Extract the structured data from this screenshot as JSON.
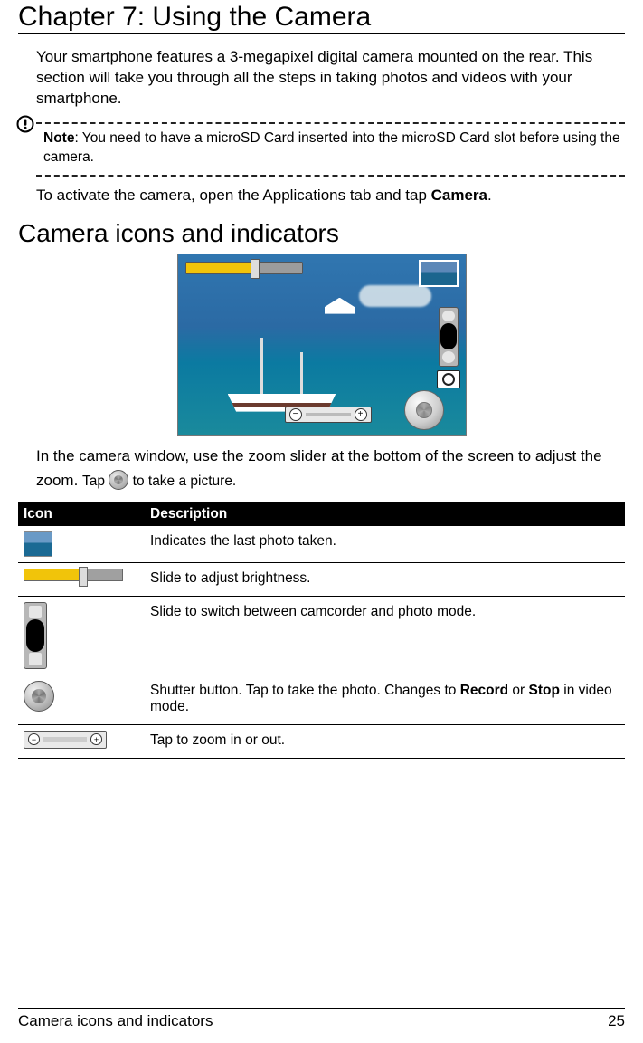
{
  "chapter_title": "Chapter 7: Using the Camera",
  "intro": "Your smartphone features a 3-megapixel digital camera mounted on the rear. This section will take you through all the steps in taking photos and videos with your smartphone.",
  "note": {
    "label": "Note",
    "text": ": You need to have a microSD Card inserted into the microSD Card slot before using the camera."
  },
  "activate": {
    "pre": "To activate the camera, open the Applications tab and tap ",
    "bold": "Camera",
    "post": "."
  },
  "section_title": "Camera icons and indicators",
  "instr": {
    "line1": "In the camera window, use the zoom slider at the bottom of the screen to adjust the zoom. ",
    "tap": "Tap ",
    "after": " to take a picture."
  },
  "table": {
    "headers": {
      "icon": "Icon",
      "desc": "Description"
    },
    "rows": [
      {
        "desc": "Indicates the last photo taken."
      },
      {
        "desc": "Slide to adjust brightness."
      },
      {
        "desc": "Slide to switch between camcorder and photo mode."
      },
      {
        "desc_pre": "Shutter button. Tap to take the photo. Changes to ",
        "b1": "Record",
        "mid": " or ",
        "b2": "Stop",
        "desc_post": " in video mode."
      },
      {
        "desc": "Tap to zoom in or out."
      }
    ]
  },
  "footer": {
    "left": "Camera icons and indicators",
    "right": "25"
  }
}
